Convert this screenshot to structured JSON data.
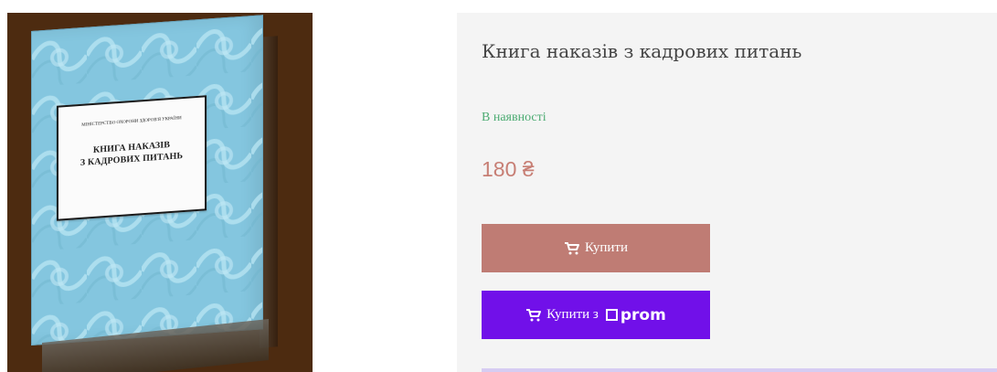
{
  "product": {
    "book_cover": {
      "ministry_text": "МІНІСТЕРСТВО ОХОРОНИ ЗДОРОВ'Я УКРАЇНИ",
      "title_line_1": "КНИГА НАКАЗІВ",
      "title_line_2": "З КАДРОВИХ ПИТАНЬ",
      "cover_color": "#84c6df",
      "background_color": "#4d2b10"
    },
    "title": "Книга наказів з кадрових питань",
    "availability": "В наявності",
    "price": "180 ₴",
    "buy_button_label": "Купити",
    "buy_prom_button_label": "Купити з",
    "prom_logo_text": "prom",
    "cart_icon": "shopping-cart-icon",
    "colors": {
      "availability": "#4cab72",
      "price": "#c77e74",
      "buy_button": "#bf7c74",
      "prom_button": "#7110e9"
    }
  }
}
